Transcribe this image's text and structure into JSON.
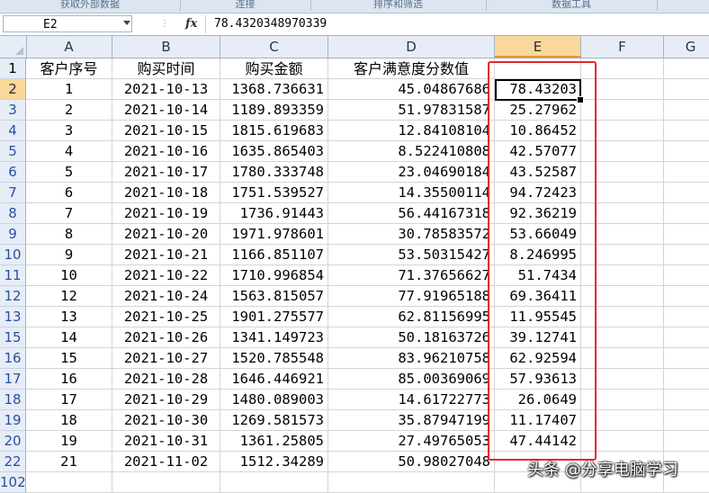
{
  "ribbon": {
    "groups": [
      "获取外部数据",
      "连接",
      "排序和筛选",
      "数据工具"
    ]
  },
  "formula_bar": {
    "name_box": "E2",
    "fx_label": "fx",
    "formula": "78.4320348970339"
  },
  "columns": [
    "A",
    "B",
    "C",
    "D",
    "E",
    "F",
    "G"
  ],
  "selected_column": "E",
  "header_row": {
    "row_num": "1",
    "a": "客户序号",
    "b": "购买时间",
    "c": "购买金额",
    "d": "客户满意度分数值",
    "e": ""
  },
  "rows": [
    {
      "row_num": "2",
      "a": "1",
      "b": "2021-10-13",
      "c": "1368.736631",
      "d": "45.04867686",
      "e": "78.43203"
    },
    {
      "row_num": "3",
      "a": "2",
      "b": "2021-10-14",
      "c": "1189.893359",
      "d": "51.97831587",
      "e": "25.27962"
    },
    {
      "row_num": "4",
      "a": "3",
      "b": "2021-10-15",
      "c": "1815.619683",
      "d": "12.84108104",
      "e": "10.86452"
    },
    {
      "row_num": "5",
      "a": "4",
      "b": "2021-10-16",
      "c": "1635.865403",
      "d": "8.522410808",
      "e": "42.57077"
    },
    {
      "row_num": "6",
      "a": "5",
      "b": "2021-10-17",
      "c": "1780.333748",
      "d": "23.04690184",
      "e": "43.52587"
    },
    {
      "row_num": "7",
      "a": "6",
      "b": "2021-10-18",
      "c": "1751.539527",
      "d": "14.35500114",
      "e": "94.72423"
    },
    {
      "row_num": "8",
      "a": "7",
      "b": "2021-10-19",
      "c": "1736.91443",
      "d": "56.44167318",
      "e": "92.36219"
    },
    {
      "row_num": "9",
      "a": "8",
      "b": "2021-10-20",
      "c": "1971.978601",
      "d": "30.78583572",
      "e": "53.66049"
    },
    {
      "row_num": "10",
      "a": "9",
      "b": "2021-10-21",
      "c": "1166.851107",
      "d": "53.50315427",
      "e": "8.246995"
    },
    {
      "row_num": "11",
      "a": "10",
      "b": "2021-10-22",
      "c": "1710.996854",
      "d": "71.37656627",
      "e": "51.7434"
    },
    {
      "row_num": "12",
      "a": "12",
      "b": "2021-10-24",
      "c": "1563.815057",
      "d": "77.91965188",
      "e": "69.36411"
    },
    {
      "row_num": "13",
      "a": "13",
      "b": "2021-10-25",
      "c": "1901.275577",
      "d": "62.81156995",
      "e": "11.95545"
    },
    {
      "row_num": "15",
      "a": "14",
      "b": "2021-10-26",
      "c": "1341.149723",
      "d": "50.18163726",
      "e": "39.12741"
    },
    {
      "row_num": "16",
      "a": "15",
      "b": "2021-10-27",
      "c": "1520.785548",
      "d": "83.96210758",
      "e": "62.92594"
    },
    {
      "row_num": "17",
      "a": "16",
      "b": "2021-10-28",
      "c": "1646.446921",
      "d": "85.00369069",
      "e": "57.93613"
    },
    {
      "row_num": "18",
      "a": "17",
      "b": "2021-10-29",
      "c": "1480.089003",
      "d": "14.61722773",
      "e": "26.0649"
    },
    {
      "row_num": "19",
      "a": "18",
      "b": "2021-10-30",
      "c": "1269.581573",
      "d": "35.87947199",
      "e": "11.17407"
    },
    {
      "row_num": "20",
      "a": "19",
      "b": "2021-10-31",
      "c": "1361.25805",
      "d": "27.49765053",
      "e": "47.44142"
    },
    {
      "row_num": "22",
      "a": "21",
      "b": "2021-11-02",
      "c": "1512.34289",
      "d": "50.98027048",
      "e": ""
    },
    {
      "row_num": "102",
      "a": "",
      "b": "",
      "c": "",
      "d": "",
      "e": ""
    }
  ],
  "watermark": "头条 @分享电脑学习",
  "colors": {
    "selection_header": "#f9d99b",
    "annotation_border": "#e5272a",
    "row_number_text": "#2a4fa0"
  }
}
